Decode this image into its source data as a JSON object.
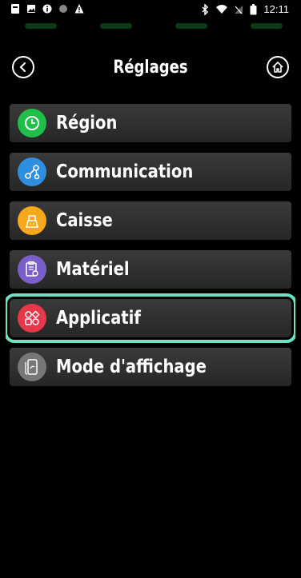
{
  "status_bar": {
    "time": "12:11",
    "left_icons": [
      "notification-icon",
      "image-icon",
      "info-icon",
      "dot-icon",
      "warning-icon"
    ],
    "right_icons": [
      "bluetooth-icon",
      "wifi-icon",
      "no-signal-icon",
      "battery-icon"
    ]
  },
  "header": {
    "title": "Réglages",
    "back_icon": "chevron-left-icon",
    "home_icon": "home-icon"
  },
  "menu": {
    "items": [
      {
        "label": "Région",
        "icon": "clock-icon",
        "color": "#1fbf4a"
      },
      {
        "label": "Communication",
        "icon": "network-icon",
        "color": "#2e8fe0"
      },
      {
        "label": "Caisse",
        "icon": "cash-register-icon",
        "color": "#f5a81c"
      },
      {
        "label": "Matériel",
        "icon": "clipboard-gear-icon",
        "color": "#7a5fc9"
      },
      {
        "label": "Applicatif",
        "icon": "apps-icon",
        "color": "#e8364a",
        "selected": true
      },
      {
        "label": "Mode d'affichage",
        "icon": "display-mode-icon",
        "color": "#777777"
      }
    ]
  },
  "colors": {
    "background": "#000000",
    "item_bg": "#303030",
    "selection_outline": "#6ee0c4",
    "led": "#0c3a17"
  }
}
